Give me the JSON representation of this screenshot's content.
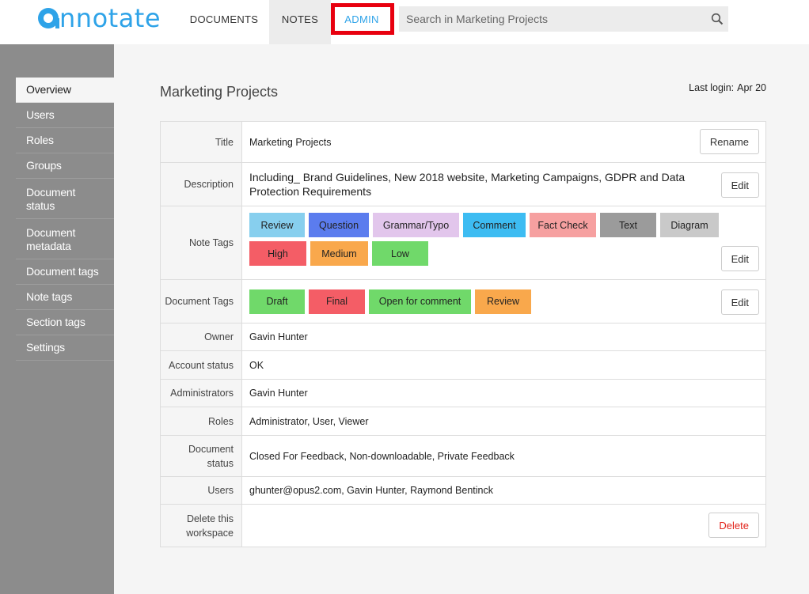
{
  "app": {
    "logo_text": "nnotate"
  },
  "nav": {
    "documents": "DOCUMENTS",
    "notes": "NOTES",
    "admin": "ADMIN"
  },
  "search": {
    "placeholder": "Search in Marketing Projects"
  },
  "sidebar": {
    "items": [
      {
        "label": "Overview"
      },
      {
        "label": "Users"
      },
      {
        "label": "Roles"
      },
      {
        "label": "Groups"
      },
      {
        "label": "Document status"
      },
      {
        "label": "Document metadata"
      },
      {
        "label": "Document tags"
      },
      {
        "label": "Note tags"
      },
      {
        "label": "Section tags"
      },
      {
        "label": "Settings"
      }
    ]
  },
  "page": {
    "title": "Marketing Projects",
    "last_login_label": "Last login:",
    "last_login_value": "Apr 20"
  },
  "rows": {
    "title": {
      "label": "Title",
      "value": "Marketing Projects",
      "button": "Rename"
    },
    "description": {
      "label": "Description",
      "value": "Including_ Brand Guidelines, New 2018 website, Marketing Campaigns, GDPR and Data Protection Requirements",
      "button": "Edit"
    },
    "note_tags": {
      "label": "Note Tags",
      "button": "Edit"
    },
    "document_tags": {
      "label": "Document Tags",
      "button": "Edit"
    },
    "owner": {
      "label": "Owner",
      "value": "Gavin Hunter"
    },
    "account_status": {
      "label": "Account status",
      "value": "OK"
    },
    "administrators": {
      "label": "Administrators",
      "value": "Gavin Hunter"
    },
    "roles": {
      "label": "Roles",
      "value": "Administrator, User, Viewer"
    },
    "document_status": {
      "label": "Document status",
      "value": "Closed For Feedback, Non-downloadable, Private Feedback"
    },
    "users": {
      "label": "Users",
      "value": "ghunter@opus2.com, Gavin Hunter, Raymond Bentinck"
    },
    "delete": {
      "label": "Delete this workspace",
      "button": "Delete"
    }
  },
  "note_tags": [
    {
      "label": "Review",
      "color": "#87cfee"
    },
    {
      "label": "Question",
      "color": "#5b7cee"
    },
    {
      "label": "Grammar/Typo",
      "color": "#e2c6ec"
    },
    {
      "label": "Comment",
      "color": "#3dbcf2"
    },
    {
      "label": "Fact Check",
      "color": "#f6a0a0"
    },
    {
      "label": "Text",
      "color": "#9b9b9b"
    },
    {
      "label": "Diagram",
      "color": "#c9c9c9"
    },
    {
      "label": "High",
      "color": "#f45d66"
    },
    {
      "label": "Medium",
      "color": "#f9a84c"
    },
    {
      "label": "Low",
      "color": "#70d96a"
    }
  ],
  "document_tags": [
    {
      "label": "Draft",
      "color": "#70d96a"
    },
    {
      "label": "Final",
      "color": "#f45d66"
    },
    {
      "label": "Open for comment",
      "color": "#70d96a"
    },
    {
      "label": "Review",
      "color": "#f9a84c"
    }
  ],
  "colors": {
    "accent": "#2ea3e8",
    "highlight_box": "#e8000f",
    "sidebar_bg": "#8c8c8c"
  }
}
